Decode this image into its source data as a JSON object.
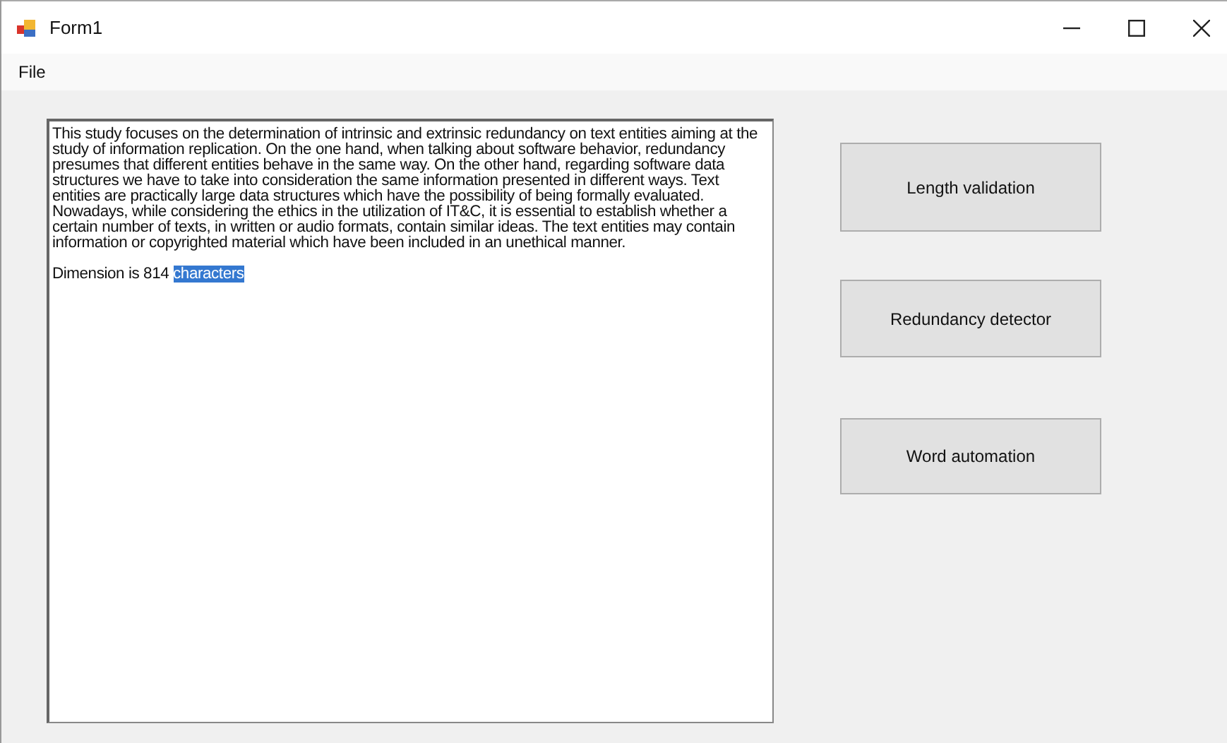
{
  "window": {
    "title": "Form1"
  },
  "menu": [
    {
      "label": "File"
    }
  ],
  "text_box": {
    "paragraphs": [
      {
        "spans": [
          {
            "text": "This study focuses on the determination of intrinsic and extrinsic redundancy on text entities aiming at the study of information replication. On the one hand, when talking about software behavior, redundancy presumes that different entities behave in the same way. On the other hand, regarding software data structures we have to take into consideration the same information presented in different ways. Text entities are practically large data structures which have the possibility of being formally evaluated.",
            "selected": false
          }
        ]
      },
      {
        "spans": [
          {
            "text": "Nowadays, while considering the ethics in the utilization of IT&C, it is essential to establish whether a certain number of texts, in written or audio formats, contain similar ideas. The text entities may contain information or copyrighted material which have been included in an unethical manner.",
            "selected": false
          }
        ]
      },
      {
        "space_before": true,
        "spans": [
          {
            "text": "Dimension is 814 ",
            "selected": false
          },
          {
            "text": "characters",
            "selected": true
          }
        ]
      }
    ]
  },
  "buttons": [
    {
      "label": "Length validation"
    },
    {
      "label": "Redundancy detector"
    },
    {
      "label": "Word automation"
    }
  ]
}
